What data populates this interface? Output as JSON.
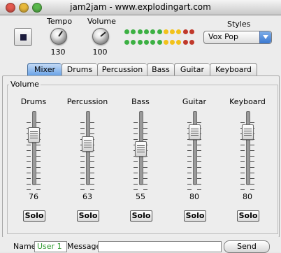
{
  "window": {
    "title": "jam2jam - www.explodingart.com"
  },
  "controls": {
    "stop_button": "stop",
    "tempo": {
      "label": "Tempo",
      "value": "130"
    },
    "volume": {
      "label": "Volume",
      "value": "100"
    }
  },
  "meter": {
    "row1": [
      "#3cb043",
      "#3cb043",
      "#3cb043",
      "#3cb043",
      "#3cb043",
      "#3cb043",
      "#f2c21a",
      "#f2c21a",
      "#f2c21a",
      "#c0392b",
      "#c0392b"
    ],
    "row2": [
      "#3cb043",
      "#3cb043",
      "#3cb043",
      "#3cb043",
      "#3cb043",
      "#3cb043",
      "#f2c21a",
      "#f2c21a",
      "#f2c21a",
      "#c0392b",
      "#c0392b"
    ]
  },
  "styles": {
    "label": "Styles",
    "selected": "Vox Pop"
  },
  "tabs": [
    "Mixer",
    "Drums",
    "Percussion",
    "Bass",
    "Guitar",
    "Keyboard"
  ],
  "active_tab": "Mixer",
  "mixer": {
    "group_title": "Volume",
    "channels": [
      {
        "name": "Drums",
        "value": "76",
        "solo": "Solo"
      },
      {
        "name": "Percussion",
        "value": "63",
        "solo": "Solo"
      },
      {
        "name": "Bass",
        "value": "55",
        "solo": "Solo"
      },
      {
        "name": "Guitar",
        "value": "80",
        "solo": "Solo"
      },
      {
        "name": "Keyboard",
        "value": "80",
        "solo": "Solo"
      }
    ]
  },
  "footer": {
    "name_label": "Name",
    "name_value": "User 1",
    "message_label": "Message",
    "message_value": "",
    "send_label": "Send"
  }
}
